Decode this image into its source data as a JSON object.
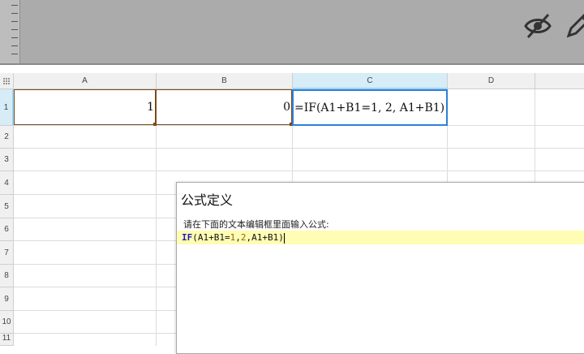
{
  "toolbar": {
    "icons": [
      "eye-slash-icon",
      "pencil-icon"
    ],
    "background": "#ababab"
  },
  "sheet": {
    "columns": [
      "A",
      "B",
      "C",
      "D"
    ],
    "rows": [
      "1",
      "2",
      "3",
      "4",
      "5",
      "6",
      "7",
      "8",
      "9",
      "10",
      "11"
    ],
    "selected_column": "C",
    "selected_row": "1",
    "cells": {
      "A1": "1",
      "B1": "0",
      "C1": "=IF(A1+B1=1, 2, A1+B1)"
    },
    "selection_color": "#2f7fd6",
    "reference_color": "#7a4a1a"
  },
  "dialog": {
    "title": "公式定义",
    "instruction": "请在下面的文本编辑框里面输入公式:",
    "editor": {
      "keyword": "IF",
      "p1": "(A1+B1=",
      "n1": "1",
      "c1": ",",
      "n2": "2",
      "p2": ",A1+B1)",
      "highlight_color": "#fffcb3"
    }
  }
}
